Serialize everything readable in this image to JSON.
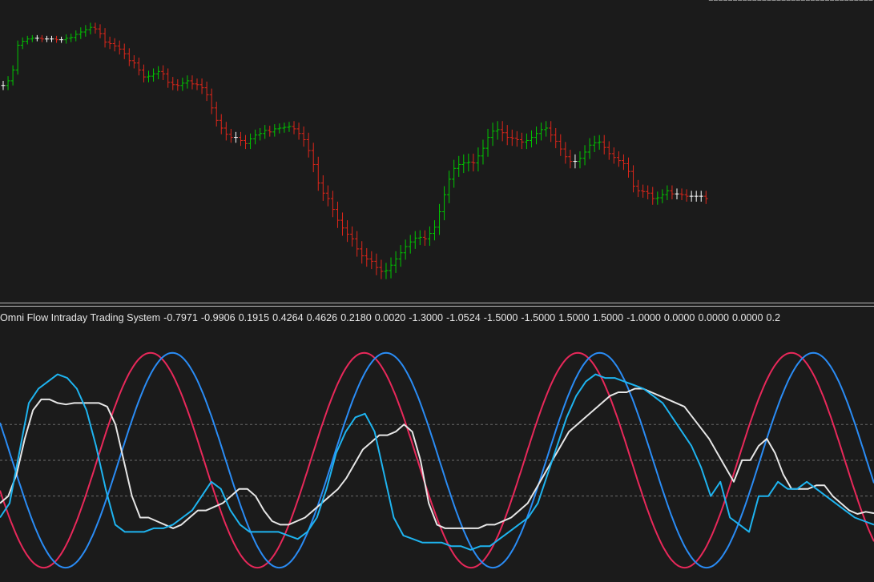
{
  "indicator": {
    "name": "Omni Flow Intraday Trading System",
    "values": [
      "-0.7971",
      "-0.9906",
      "0.1915",
      "0.4264",
      "0.4626",
      "0.2180",
      "0.0020",
      "-1.3000",
      "-1.0524",
      "-1.5000",
      "-1.5000",
      "1.5000",
      "1.5000",
      "-1.0000",
      "0.0000",
      "0.0000",
      "0.0000",
      "0.2"
    ]
  },
  "chart_data": [
    {
      "type": "candlestick",
      "title": "",
      "xlabel": "",
      "ylabel": "",
      "grid": false,
      "colors": {
        "up": "#00c800",
        "down": "#e0261b",
        "doji": "#ffffff",
        "background": "#1b1b1b"
      },
      "ylim": [
        0,
        370
      ],
      "x": [
        0,
        1,
        2,
        3,
        4,
        5,
        6,
        7,
        8,
        9,
        10,
        11,
        12,
        13,
        14,
        15,
        16,
        17,
        18,
        19,
        20,
        21,
        22,
        23,
        24,
        25,
        26,
        27,
        28,
        29,
        30,
        31,
        32,
        33,
        34,
        35,
        36,
        37,
        38,
        39,
        40,
        41,
        42,
        43,
        44,
        45,
        46,
        47,
        48,
        49,
        50,
        51,
        52,
        53,
        54,
        55,
        56,
        57,
        58,
        59,
        60,
        61,
        62,
        63,
        64,
        65,
        66,
        67,
        68,
        69,
        70,
        71,
        72,
        73,
        74,
        75,
        76,
        77,
        78,
        79,
        80,
        81,
        82,
        83,
        84,
        85,
        86,
        87,
        88,
        89,
        90,
        91,
        92,
        93,
        94,
        95,
        96,
        97,
        98,
        99,
        100,
        101,
        102,
        103,
        104,
        105,
        106,
        107,
        108,
        109,
        110,
        111,
        112,
        113,
        114,
        115,
        116,
        117,
        118,
        119,
        120,
        121,
        122,
        123,
        124,
        125,
        126,
        127,
        128,
        129,
        130,
        131,
        132,
        133,
        134,
        135,
        136,
        137,
        138,
        139,
        140,
        141,
        142,
        143,
        144,
        145,
        146,
        147,
        148,
        149,
        150,
        151,
        152,
        153,
        154,
        155,
        156,
        157,
        158,
        159,
        160,
        161,
        162,
        163,
        164,
        165,
        166,
        167,
        168,
        169,
        170,
        171,
        172,
        173,
        174,
        175,
        176,
        177,
        178,
        179
      ],
      "close": [
        270,
        276,
        290,
        322,
        327,
        330,
        331,
        331,
        330,
        330,
        330,
        329,
        329,
        331,
        332,
        336,
        339,
        342,
        345,
        343,
        337,
        326,
        324,
        321,
        317,
        311,
        302,
        299,
        290,
        281,
        282,
        285,
        288,
        285,
        274,
        271,
        270,
        273,
        276,
        272,
        271,
        267,
        258,
        241,
        225,
        215,
        207,
        203,
        203,
        199,
        195,
        201,
        206,
        208,
        212,
        210,
        214,
        215,
        216,
        217,
        214,
        208,
        200,
        186,
        168,
        144,
        131,
        124,
        110,
        96,
        86,
        78,
        72,
        59,
        50,
        46,
        43,
        35,
        30,
        31,
        38,
        46,
        54,
        62,
        68,
        73,
        74,
        72,
        79,
        87,
        107,
        129,
        149,
        163,
        168,
        170,
        171,
        170,
        179,
        189,
        203,
        211,
        213,
        209,
        203,
        202,
        200,
        197,
        199,
        203,
        208,
        213,
        215,
        206,
        198,
        188,
        178,
        172,
        172,
        176,
        184,
        193,
        196,
        197,
        190,
        182,
        177,
        173,
        169,
        159,
        140,
        134,
        133,
        131,
        124,
        125,
        129,
        134,
        130,
        130,
        129,
        127,
        127,
        127,
        127,
        124
      ],
      "open": [
        270,
        270,
        276,
        290,
        322,
        327,
        330,
        331,
        331,
        330,
        330,
        330,
        329,
        329,
        331,
        332,
        336,
        339,
        342,
        345,
        343,
        337,
        326,
        324,
        321,
        317,
        311,
        302,
        299,
        290,
        281,
        282,
        285,
        288,
        285,
        274,
        271,
        270,
        273,
        276,
        272,
        271,
        267,
        258,
        241,
        225,
        215,
        207,
        203,
        203,
        199,
        195,
        201,
        206,
        208,
        212,
        210,
        214,
        215,
        216,
        217,
        214,
        208,
        200,
        186,
        168,
        144,
        131,
        124,
        110,
        96,
        86,
        78,
        72,
        59,
        50,
        46,
        43,
        35,
        30,
        31,
        38,
        46,
        54,
        62,
        68,
        73,
        74,
        72,
        79,
        87,
        107,
        129,
        149,
        163,
        168,
        170,
        171,
        170,
        179,
        189,
        203,
        211,
        213,
        209,
        203,
        202,
        200,
        197,
        199,
        203,
        208,
        213,
        215,
        206,
        198,
        188,
        178,
        172,
        172,
        176,
        184,
        193,
        196,
        197,
        190,
        182,
        177,
        173,
        169,
        159,
        140,
        134,
        133,
        131,
        124,
        125,
        129,
        134,
        130,
        130,
        129,
        127,
        127,
        127,
        127
      ],
      "range": [
        12,
        12,
        12,
        12,
        10,
        8,
        8,
        8,
        8,
        8,
        8,
        8,
        8,
        10,
        10,
        10,
        12,
        12,
        12,
        12,
        12,
        14,
        14,
        14,
        14,
        14,
        14,
        14,
        14,
        14,
        14,
        14,
        14,
        16,
        14,
        14,
        14,
        14,
        14,
        14,
        14,
        16,
        16,
        16,
        16,
        16,
        16,
        14,
        14,
        14,
        14,
        14,
        14,
        14,
        14,
        12,
        12,
        12,
        12,
        12,
        14,
        16,
        18,
        18,
        20,
        20,
        20,
        20,
        20,
        20,
        20,
        20,
        20,
        20,
        20,
        20,
        20,
        20,
        20,
        20,
        20,
        20,
        20,
        18,
        18,
        18,
        18,
        18,
        18,
        18,
        20,
        22,
        22,
        22,
        22,
        22,
        22,
        22,
        22,
        22,
        22,
        22,
        22,
        22,
        20,
        20,
        18,
        18,
        18,
        18,
        18,
        18,
        18,
        18,
        18,
        18,
        18,
        18,
        18,
        18,
        18,
        18,
        18,
        18,
        18,
        16,
        16,
        16,
        16,
        16,
        16,
        16,
        16,
        16,
        16,
        16,
        14,
        14,
        14,
        14,
        14,
        14,
        14,
        14,
        14,
        14
      ]
    },
    {
      "type": "line",
      "title": "",
      "xlabel": "",
      "ylabel": "",
      "grid": false,
      "ylim": [
        -1.7,
        1.9
      ],
      "levels": [
        -0.5,
        0.0,
        0.5
      ],
      "colors": {
        "level": "#6b6b6b"
      },
      "x_count": 180,
      "series": [
        {
          "color": "#e8285a",
          "width": 2,
          "dash": "",
          "kind": "sine",
          "period": 44,
          "phase": 0.0,
          "amplitude": 1.5
        },
        {
          "color": "#2a8cf5",
          "width": 2,
          "dash": "",
          "kind": "sine",
          "period": 44,
          "phase": 4.5,
          "amplitude": 1.5
        },
        {
          "color": "#e6e6e6",
          "width": 2,
          "dash": "",
          "kind": "points",
          "values": [
            -0.6,
            -0.5,
            -0.2,
            0.3,
            0.7,
            0.85,
            0.85,
            0.8,
            0.78,
            0.8,
            0.8,
            0.8,
            0.8,
            0.75,
            0.5,
            0.0,
            -0.5,
            -0.8,
            -0.8,
            -0.85,
            -0.9,
            -0.95,
            -0.9,
            -0.8,
            -0.7,
            -0.7,
            -0.65,
            -0.6,
            -0.5,
            -0.4,
            -0.4,
            -0.5,
            -0.7,
            -0.85,
            -0.9,
            -0.9,
            -0.85,
            -0.8,
            -0.7,
            -0.6,
            -0.5,
            -0.4,
            -0.25,
            -0.05,
            0.15,
            0.25,
            0.35,
            0.35,
            0.4,
            0.5,
            0.4,
            0.0,
            -0.6,
            -0.9,
            -0.95,
            -0.95,
            -0.95,
            -0.95,
            -0.95,
            -0.9,
            -0.9,
            -0.85,
            -0.8,
            -0.7,
            -0.6,
            -0.4,
            -0.2,
            0.0,
            0.2,
            0.4,
            0.5,
            0.6,
            0.7,
            0.8,
            0.9,
            0.95,
            0.95,
            1.0,
            1.0,
            0.95,
            0.9,
            0.85,
            0.8,
            0.75,
            0.6,
            0.45,
            0.3,
            0.1,
            -0.1,
            -0.3,
            0.0,
            0.0,
            0.2,
            0.3,
            0.1,
            -0.2,
            -0.4,
            -0.4,
            -0.4,
            -0.35,
            -0.35,
            -0.5,
            -0.6,
            -0.7,
            -0.75,
            -0.72,
            -0.74
          ]
        },
        {
          "color": "#1eb4f0",
          "width": 2,
          "dash": "",
          "kind": "points",
          "values": [
            -0.8,
            -0.6,
            0.1,
            0.8,
            1.0,
            1.1,
            1.2,
            1.15,
            1.0,
            0.7,
            0.2,
            -0.4,
            -0.9,
            -1.0,
            -1.0,
            -1.0,
            -0.95,
            -0.95,
            -0.9,
            -0.8,
            -0.7,
            -0.5,
            -0.3,
            -0.4,
            -0.7,
            -0.9,
            -1.0,
            -1.0,
            -1.0,
            -1.0,
            -1.05,
            -1.1,
            -1.0,
            -0.8,
            -0.4,
            0.1,
            0.4,
            0.6,
            0.65,
            0.4,
            -0.2,
            -0.8,
            -1.05,
            -1.1,
            -1.15,
            -1.15,
            -1.15,
            -1.2,
            -1.2,
            -1.25,
            -1.2,
            -1.2,
            -1.1,
            -1.0,
            -0.9,
            -0.8,
            -0.6,
            -0.2,
            0.2,
            0.6,
            0.9,
            1.1,
            1.2,
            1.15,
            1.15,
            1.1,
            1.05,
            1.0,
            0.9,
            0.8,
            0.6,
            0.4,
            0.2,
            -0.1,
            -0.5,
            -0.3,
            -0.8,
            -0.9,
            -1.0,
            -0.5,
            -0.5,
            -0.3,
            -0.4,
            -0.4,
            -0.3,
            -0.4,
            -0.5,
            -0.6,
            -0.7,
            -0.8,
            -0.85,
            -0.9
          ]
        }
      ]
    }
  ]
}
